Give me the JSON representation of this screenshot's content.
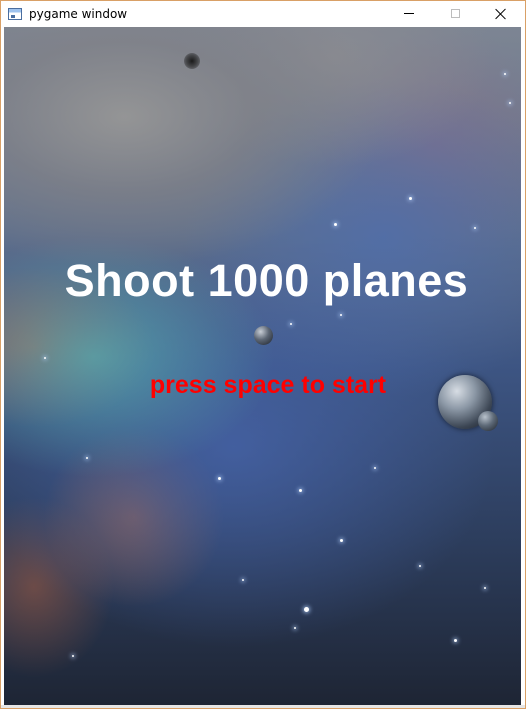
{
  "window": {
    "title": "pygame window",
    "controls": {
      "minimize_icon": "minimize-icon",
      "maximize_icon": "maximize-icon",
      "close_icon": "close-icon"
    }
  },
  "game": {
    "title": "Shoot 1000 planes",
    "prompt": "press space to start",
    "colors": {
      "title": "#ffffff",
      "prompt": "#ff0000"
    }
  }
}
